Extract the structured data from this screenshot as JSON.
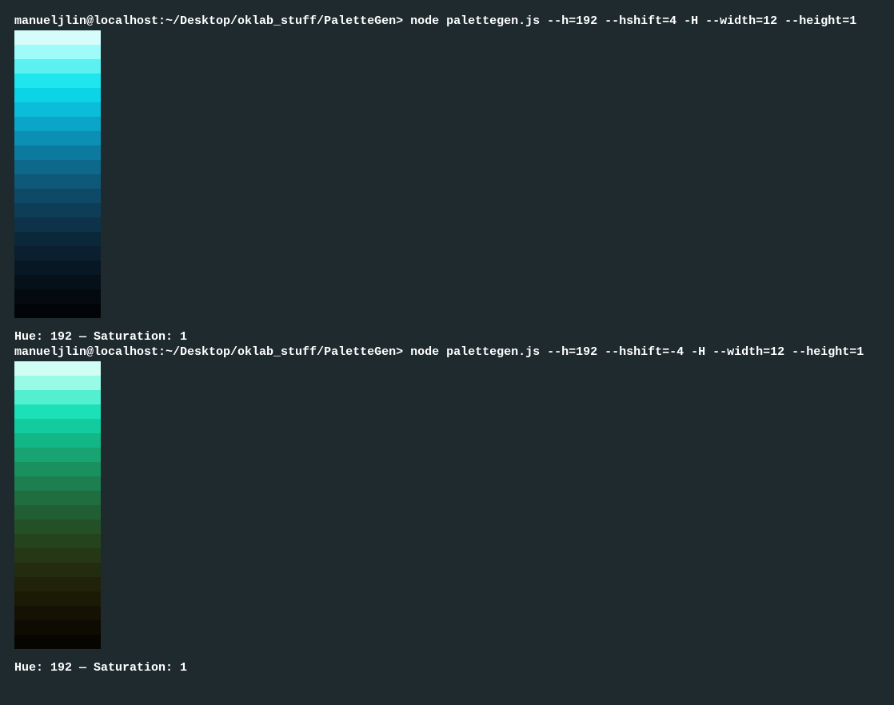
{
  "blocks": [
    {
      "prompt": "manueljlin@localhost:~/Desktop/oklab_stuff/PaletteGen>",
      "command": "node palettegen.js --h=192 --hshift=4 -H --width=12 --height=1",
      "swatches": [
        "#d4fdfc",
        "#9ffbf9",
        "#5bf1f0",
        "#1fe5ed",
        "#0dd3e6",
        "#0bbdd9",
        "#0aa5c7",
        "#0b8fb4",
        "#0c7a9f",
        "#0d688c",
        "#0e5879",
        "#0e4a68",
        "#0e3d58",
        "#0d3249",
        "#0b283b",
        "#0a1f2f",
        "#081724",
        "#061019",
        "#040a10",
        "#020508"
      ],
      "info": "Hue: 192 — Saturation: 1"
    },
    {
      "prompt": "manueljlin@localhost:~/Desktop/oklab_stuff/PaletteGen>",
      "command": "node palettegen.js --h=192 --hshift=-4 -H --width=12 --height=1",
      "swatches": [
        "#d0fdf4",
        "#98fbe6",
        "#53efd0",
        "#1be0b8",
        "#12cc9f",
        "#13b787",
        "#17a372",
        "#1a905f",
        "#1d7e4f",
        "#206d40",
        "#225e33",
        "#245027",
        "#25431d",
        "#253715",
        "#232c0e",
        "#202209",
        "#1b1a05",
        "#151203",
        "#0e0b02",
        "#070501"
      ],
      "info": "Hue: 192 — Saturation: 1"
    }
  ]
}
